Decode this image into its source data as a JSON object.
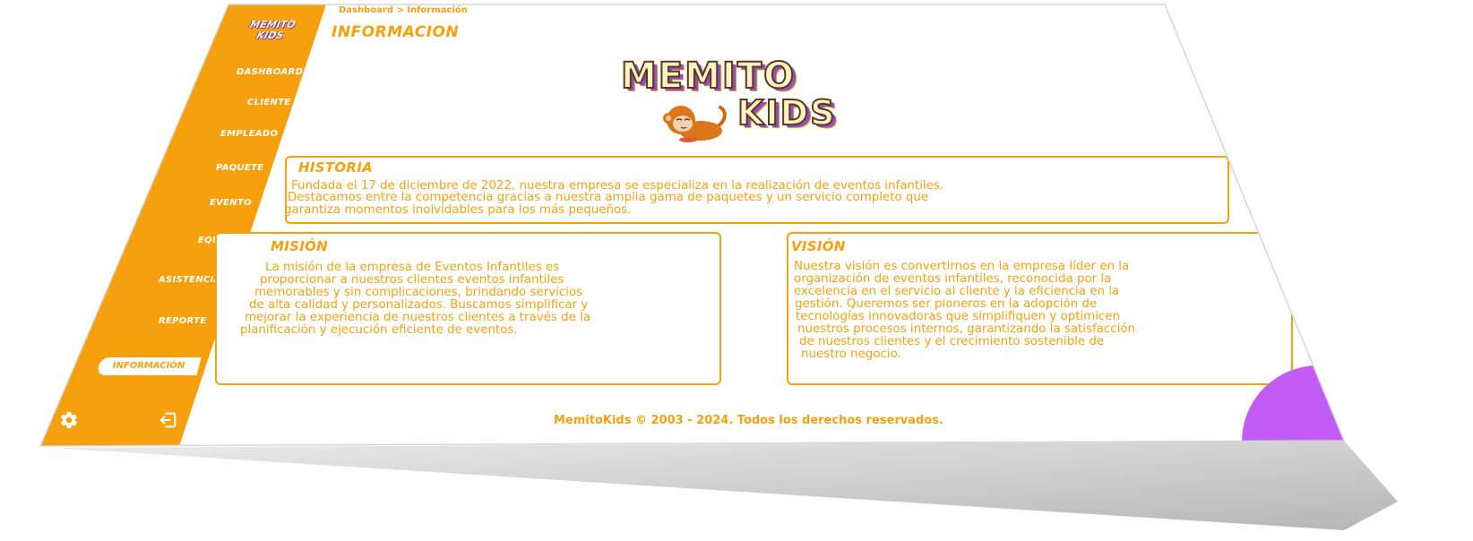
{
  "brand": {
    "name": "MemitoKids",
    "logo_line1": "MEMITO",
    "logo_line2": "KIDS"
  },
  "colors": {
    "accent": "#f7a00e",
    "secondary": "#c35bf5",
    "background": "#ffffff"
  },
  "sidebar": {
    "items": [
      {
        "label": "DASHBOARD"
      },
      {
        "label": "CLIENTE"
      },
      {
        "label": "EMPLEADO"
      },
      {
        "label": "PAQUETE"
      },
      {
        "label": "EVENTO"
      },
      {
        "label": "EQUIPO"
      },
      {
        "label": "ASISTENCIA"
      },
      {
        "label": "REPORTE"
      },
      {
        "label": "INFORMACIÓN",
        "active": true
      }
    ],
    "settings_icon": "gear-icon",
    "logout_icon": "logout-icon"
  },
  "header": {
    "breadcrumb": "Dashboard > Información",
    "title": "INFORMACION"
  },
  "historia": {
    "title": "HISTORIA",
    "lines": [
      "Fundada el 17 de diciembre de 2022, nuestra empresa se especializa en la realización de eventos infantiles.",
      "Destacamos entre la competencia gracias a nuestra amplia gama de paquetes y un servicio completo que",
      "garantiza momentos inolvidables para los más pequeños."
    ]
  },
  "mision": {
    "title": "MISIÓN",
    "lines": [
      "La misión de la empresa de Eventos Infantiles es",
      "proporcionar a nuestros clientes eventos infantiles",
      "memorables y sin complicaciones, brindando servicios",
      "de alta calidad y personalizados. Buscamos simplificar y",
      "mejorar la experiencia de nuestros clientes a través de la",
      "planificación y ejecución eficiente de eventos."
    ]
  },
  "vision": {
    "title": "VISIÓN",
    "lines": [
      "Nuestra visión es convertirnos en la empresa líder en la",
      "organización de eventos infantiles, reconocida por la",
      "excelencia en el servicio al cliente y la eficiencia en la",
      "gestión. Queremos ser pioneros en la adopción de",
      "tecnologías innovadoras que simplifiquen y optimicen",
      "nuestros procesos internos, garantizando la satisfacción",
      "de nuestros clientes y el crecimiento sostenible de",
      "nuestro negocio."
    ]
  },
  "footer": {
    "text": "MemitoKids © 2003 - 2024. Todos los derechos reservados."
  }
}
